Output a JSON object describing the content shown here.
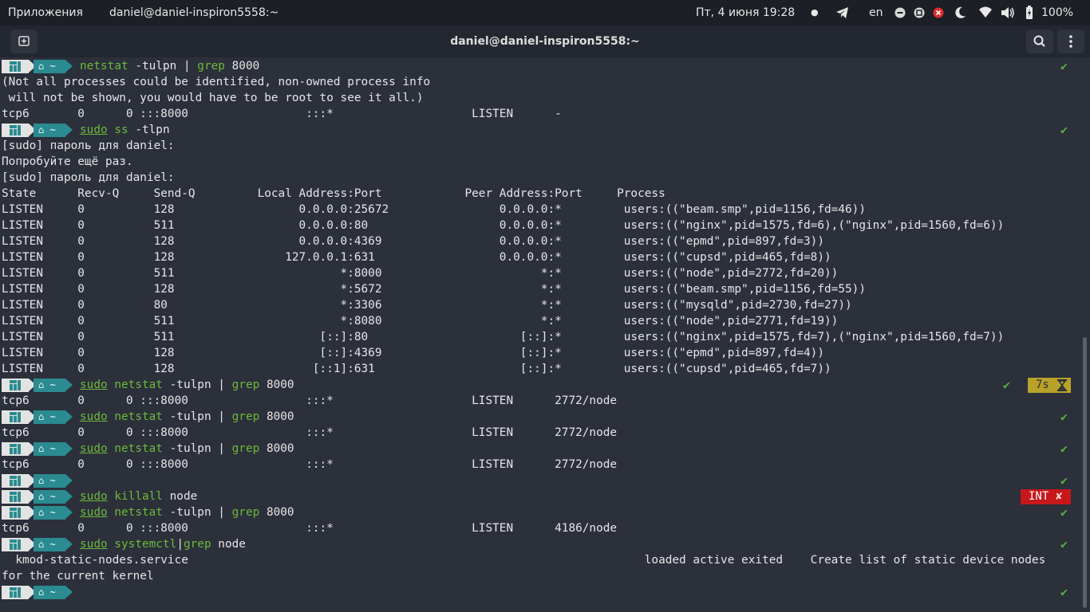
{
  "topbar": {
    "apps_label": "Приложения",
    "window_title": "daniel@daniel-inspiron5558:~",
    "datetime": "Пт, 4 июня  19:28",
    "keyboard_layout": "en",
    "battery": "100%"
  },
  "titlebar": {
    "title": "daniel@daniel-inspiron5558:~"
  },
  "terminal": {
    "check_symbol": "✔",
    "lines": [
      {
        "type": "prompt",
        "status": "ok",
        "cmd": [
          {
            "t": "netstat",
            "c": "g"
          },
          {
            "t": " -tulpn | "
          },
          {
            "t": "grep",
            "c": "g"
          },
          {
            "t": " 8000"
          }
        ]
      },
      {
        "type": "output",
        "text": "(Not all processes could be identified, non-owned process info"
      },
      {
        "type": "output",
        "text": " will not be shown, you would have to be root to see it all.)"
      },
      {
        "type": "output",
        "text": "tcp6       0      0 :::8000                 :::*                    LISTEN      -"
      },
      {
        "type": "prompt",
        "status": "ok",
        "cmd": [
          {
            "t": "sudo",
            "c": "g u"
          },
          {
            "t": " "
          },
          {
            "t": "ss",
            "c": "g"
          },
          {
            "t": " -tlpn"
          }
        ]
      },
      {
        "type": "output",
        "text": "[sudo] пароль для daniel:"
      },
      {
        "type": "output",
        "text": "Попробуйте ещё раз."
      },
      {
        "type": "output",
        "text": "[sudo] пароль для daniel:"
      },
      {
        "type": "output",
        "text": "State      Recv-Q     Send-Q         Local Address:Port            Peer Address:Port     Process"
      },
      {
        "type": "output",
        "text": "LISTEN     0          128                  0.0.0.0:25672                0.0.0.0:*         users:((\"beam.smp\",pid=1156,fd=46))"
      },
      {
        "type": "output",
        "text": "LISTEN     0          511                  0.0.0.0:80                   0.0.0.0:*         users:((\"nginx\",pid=1575,fd=6),(\"nginx\",pid=1560,fd=6))"
      },
      {
        "type": "output",
        "text": "LISTEN     0          128                  0.0.0.0:4369                 0.0.0.0:*         users:((\"epmd\",pid=897,fd=3))"
      },
      {
        "type": "output",
        "text": "LISTEN     0          128                127.0.0.1:631                  0.0.0.0:*         users:((\"cupsd\",pid=465,fd=8))"
      },
      {
        "type": "output",
        "text": "LISTEN     0          511                        *:8000                       *:*         users:((\"node\",pid=2772,fd=20))"
      },
      {
        "type": "output",
        "text": "LISTEN     0          128                        *:5672                       *:*         users:((\"beam.smp\",pid=1156,fd=55))"
      },
      {
        "type": "output",
        "text": "LISTEN     0          80                         *:3306                       *:*         users:((\"mysqld\",pid=2730,fd=27))"
      },
      {
        "type": "output",
        "text": "LISTEN     0          511                        *:8080                       *:*         users:((\"node\",pid=2771,fd=19))"
      },
      {
        "type": "output",
        "text": "LISTEN     0          511                     [::]:80                      [::]:*         users:((\"nginx\",pid=1575,fd=7),(\"nginx\",pid=1560,fd=7))"
      },
      {
        "type": "output",
        "text": "LISTEN     0          128                     [::]:4369                    [::]:*         users:((\"epmd\",pid=897,fd=4))"
      },
      {
        "type": "output",
        "text": "LISTEN     0          128                    [::1]:631                     [::]:*         users:((\"cupsd\",pid=465,fd=7))"
      },
      {
        "type": "prompt",
        "status": "ok",
        "duration": "7s",
        "cmd": [
          {
            "t": "sudo",
            "c": "g u"
          },
          {
            "t": " "
          },
          {
            "t": "netstat",
            "c": "g"
          },
          {
            "t": " -tulpn | "
          },
          {
            "t": "grep",
            "c": "g"
          },
          {
            "t": " 8000"
          }
        ]
      },
      {
        "type": "output",
        "text": "tcp6       0      0 :::8000                 :::*                    LISTEN      2772/node"
      },
      {
        "type": "prompt",
        "status": "ok",
        "cmd": [
          {
            "t": "sudo",
            "c": "g u"
          },
          {
            "t": " "
          },
          {
            "t": "netstat",
            "c": "g"
          },
          {
            "t": " -tulpn | "
          },
          {
            "t": "grep",
            "c": "g"
          },
          {
            "t": " 8000"
          }
        ]
      },
      {
        "type": "output",
        "text": "tcp6       0      0 :::8000                 :::*                    LISTEN      2772/node"
      },
      {
        "type": "prompt",
        "status": "ok",
        "cmd": [
          {
            "t": "sudo",
            "c": "g u"
          },
          {
            "t": " "
          },
          {
            "t": "netstat",
            "c": "g"
          },
          {
            "t": " -tulpn | "
          },
          {
            "t": "grep",
            "c": "g"
          },
          {
            "t": " 8000"
          }
        ]
      },
      {
        "type": "output",
        "text": "tcp6       0      0 :::8000                 :::*                    LISTEN      2772/node"
      },
      {
        "type": "prompt",
        "status": "ok",
        "cmd": []
      },
      {
        "type": "prompt",
        "status": "int",
        "status_text": "INT",
        "status_mark": "✘",
        "cmd": [
          {
            "t": "sudo",
            "c": "g u"
          },
          {
            "t": " "
          },
          {
            "t": "killall",
            "c": "g"
          },
          {
            "t": " node"
          }
        ]
      },
      {
        "type": "prompt",
        "status": "ok",
        "cmd": [
          {
            "t": "sudo",
            "c": "g u"
          },
          {
            "t": " "
          },
          {
            "t": "netstat",
            "c": "g"
          },
          {
            "t": " -tulpn | "
          },
          {
            "t": "grep",
            "c": "g"
          },
          {
            "t": " 8000"
          }
        ]
      },
      {
        "type": "output",
        "text": "tcp6       0      0 :::8000                 :::*                    LISTEN      4186/node"
      },
      {
        "type": "prompt",
        "status": "ok",
        "cmd": [
          {
            "t": "sudo",
            "c": "g u"
          },
          {
            "t": " "
          },
          {
            "t": "systemctl",
            "c": "g"
          },
          {
            "t": "|"
          },
          {
            "t": "grep",
            "c": "g"
          },
          {
            "t": " node"
          }
        ]
      },
      {
        "type": "output",
        "text": "  kmod-static-nodes.service                                                                  loaded active exited    Create list of static device nodes"
      },
      {
        "type": "output",
        "text": "for the current kernel"
      },
      {
        "type": "prompt",
        "status": "ok",
        "cmd": []
      }
    ]
  }
}
